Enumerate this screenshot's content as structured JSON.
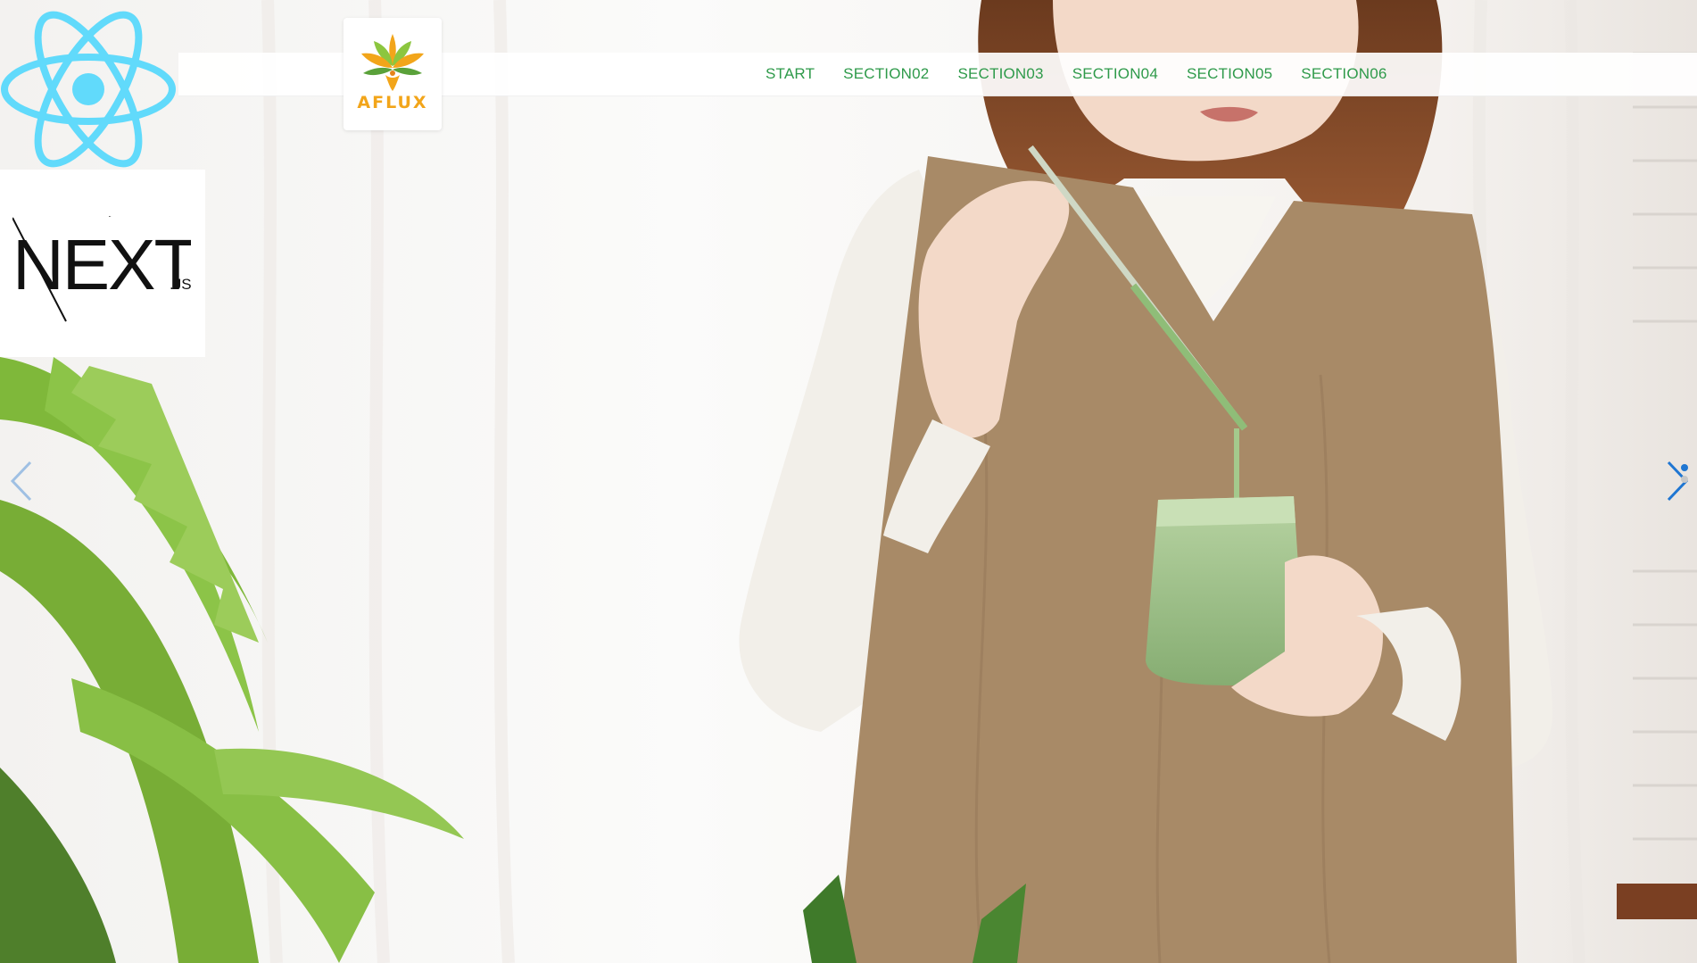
{
  "logos": {
    "next_wordmark": "NEXT",
    "next_suffix": ".JS"
  },
  "brand": {
    "name": "AFLUX",
    "color": "#f2a51a",
    "icon": "lotus-flower-icon"
  },
  "nav": {
    "items": [
      {
        "label": "START"
      },
      {
        "label": "SECTION02"
      },
      {
        "label": "SECTION03"
      },
      {
        "label": "SECTION04"
      },
      {
        "label": "SECTION05"
      },
      {
        "label": "SECTION06"
      }
    ],
    "color": "#2e9a4a"
  },
  "carousel": {
    "prev_icon": "chevron-left-icon",
    "next_icon": "chevron-right-icon",
    "accent": "#1f76d2",
    "slide_count": 2,
    "active_index": 0
  },
  "colors": {
    "react_cyan": "#61dafb",
    "apron": "#a88a67",
    "sweater": "#f2efe9",
    "drink": "#93b97f",
    "leaf": "#7fb83a"
  }
}
